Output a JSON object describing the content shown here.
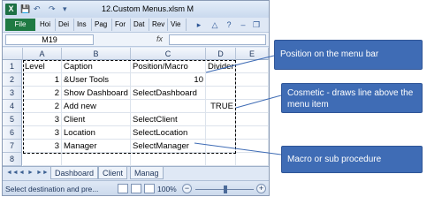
{
  "window": {
    "title": "12.Custom Menus.xlsm M",
    "app_logo": "X",
    "qat_icons": [
      "save-icon",
      "undo-icon",
      "redo-icon",
      "customize-icon"
    ]
  },
  "ribbon": {
    "file_tab": "File",
    "tabs": [
      "Hoi",
      "Dei",
      "Ins",
      "Pag",
      "For",
      "Dat",
      "Rev",
      "Vie"
    ]
  },
  "formula_bar": {
    "name_box": "M19",
    "fx": "fx",
    "value": ""
  },
  "sheet": {
    "columns": [
      "A",
      "B",
      "C",
      "D",
      "E"
    ],
    "rows": [
      {
        "num": "1",
        "a": "Level",
        "b": "Caption",
        "c": "Position/Macro",
        "d": "Divider",
        "e": ""
      },
      {
        "num": "2",
        "a": "1",
        "b": "&User Tools",
        "c": "10",
        "d": "",
        "e": ""
      },
      {
        "num": "3",
        "a": "2",
        "b": "Show Dashboard",
        "c": "SelectDashboard",
        "d": "",
        "e": ""
      },
      {
        "num": "4",
        "a": "2",
        "b": "Add new",
        "c": "",
        "d": "TRUE",
        "e": ""
      },
      {
        "num": "5",
        "a": "3",
        "b": "Client",
        "c": "SelectClient",
        "d": "",
        "e": ""
      },
      {
        "num": "6",
        "a": "3",
        "b": "Location",
        "c": "SelectLocation",
        "d": "",
        "e": ""
      },
      {
        "num": "7",
        "a": "3",
        "b": "Manager",
        "c": "SelectManager",
        "d": "",
        "e": ""
      },
      {
        "num": "8",
        "a": "",
        "b": "",
        "c": "",
        "d": "",
        "e": ""
      }
    ],
    "tabs": [
      "Dashboard",
      "Client",
      "Manag"
    ]
  },
  "status": {
    "message": "Select destination and pre...",
    "zoom": "100%",
    "zoom_out": "−",
    "zoom_in": "+"
  },
  "callouts": {
    "menu_bar": "Position on the menu bar",
    "cosmetic": "Cosmetic - draws line above the menu item",
    "macro": "Macro or sub procedure"
  },
  "colors": {
    "accent": "#3f6cb5",
    "file_tab": "#1f7a43"
  }
}
